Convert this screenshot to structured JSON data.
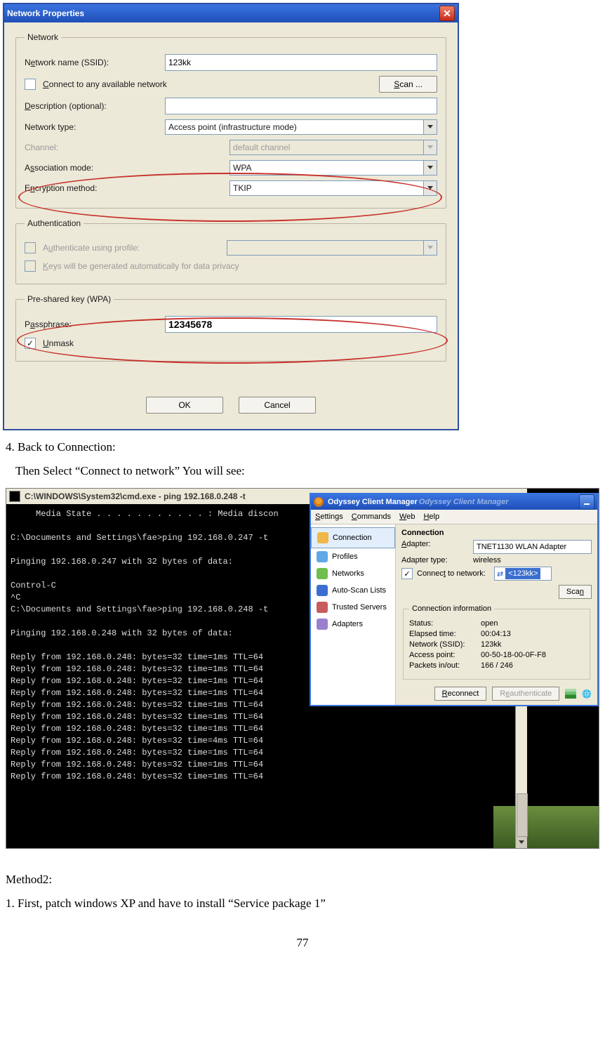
{
  "dialog": {
    "title": "Network Properties",
    "groups": {
      "network": {
        "legend": "Network",
        "ssid_label_pre": "N",
        "ssid_label_ul": "e",
        "ssid_label_post": "twork name (SSID):",
        "ssid_value": "123kk",
        "connect_any_pre": "",
        "connect_any_ul": "C",
        "connect_any_post": "onnect to any available network",
        "scan_pre": "",
        "scan_ul": "S",
        "scan_post": "can ...",
        "desc_ul": "D",
        "desc_post": "escription (optional):",
        "desc_value": "",
        "type_label": "Network type:",
        "type_value": "Access point (infrastructure mode)",
        "channel_label": "Channel:",
        "channel_value": "default channel",
        "assoc_pre": "A",
        "assoc_ul": "s",
        "assoc_post": "sociation mode:",
        "assoc_value": "WPA",
        "enc_pre": "E",
        "enc_ul": "n",
        "enc_post": "cryption method:",
        "enc_value": "TKIP"
      },
      "auth": {
        "legend": "Authentication",
        "auth_pre": "A",
        "auth_ul": "u",
        "auth_post": "thenticate using profile:",
        "keys_pre": "",
        "keys_ul": "K",
        "keys_post": "eys will be generated automatically for data privacy"
      },
      "psk": {
        "legend": "Pre-shared key (WPA)",
        "pass_pre": "P",
        "pass_ul": "a",
        "pass_post": "ssphrase:",
        "pass_value": "12345678",
        "unmask_ul": "U",
        "unmask_post": "nmask"
      }
    },
    "ok": "OK",
    "cancel": "Cancel"
  },
  "body": {
    "step4": "4. Back to Connection:",
    "step4b": "Then Select “Connect to network” You will see:",
    "method2": "Method2:",
    "method2_1": "1. First, patch windows XP and have to install “Service package 1”",
    "pagenum": "77"
  },
  "cmd": {
    "title": "C:\\WINDOWS\\System32\\cmd.exe - ping 192.168.0.248 -t",
    "lines": "     Media State . . . . . . . . . . . : Media discon\n\nC:\\Documents and Settings\\fae>ping 192.168.0.247 -t\n\nPinging 192.168.0.247 with 32 bytes of data:\n\nControl-C\n^C\nC:\\Documents and Settings\\fae>ping 192.168.0.248 -t\n\nPinging 192.168.0.248 with 32 bytes of data:\n\nReply from 192.168.0.248: bytes=32 time=1ms TTL=64\nReply from 192.168.0.248: bytes=32 time=1ms TTL=64\nReply from 192.168.0.248: bytes=32 time=1ms TTL=64\nReply from 192.168.0.248: bytes=32 time=1ms TTL=64\nReply from 192.168.0.248: bytes=32 time=1ms TTL=64\nReply from 192.168.0.248: bytes=32 time=1ms TTL=64\nReply from 192.168.0.248: bytes=32 time=1ms TTL=64\nReply from 192.168.0.248: bytes=32 time=4ms TTL=64\nReply from 192.168.0.248: bytes=32 time=1ms TTL=64\nReply from 192.168.0.248: bytes=32 time=1ms TTL=64\nReply from 192.168.0.248: bytes=32 time=1ms TTL=64"
  },
  "ocm": {
    "title": "Odyssey Client Manager",
    "menu": {
      "settings": "Settings",
      "settings_ul": "S",
      "commands": "Commands",
      "commands_ul": "C",
      "web": "Web",
      "web_ul": "W",
      "help": "Help",
      "help_ul": "H"
    },
    "side": [
      "Connection",
      "Profiles",
      "Networks",
      "Auto-Scan Lists",
      "Trusted Servers",
      "Adapters"
    ],
    "main": {
      "heading": "Connection",
      "adapter_ul": "A",
      "adapter_post": "dapter:",
      "adapter_value": "TNET1130 WLAN Adapter",
      "adapter_type_lbl": "Adapter type:",
      "adapter_type_val": "wireless",
      "connect_pre": "Connec",
      "connect_ul": "t",
      "connect_post": " to network:",
      "network_value": "<123kk>",
      "scan_pre": "Sca",
      "scan_ul": "n",
      "ci_legend": "Connection information",
      "status_lbl": "Status:",
      "status_val": "open",
      "elapsed_lbl": "Elapsed time:",
      "elapsed_val": "00:04:13",
      "ssid_lbl": "Network (SSID):",
      "ssid_val": "123kk",
      "ap_lbl": "Access point:",
      "ap_val": "00-50-18-00-0F-F8",
      "pkts_lbl": "Packets in/out:",
      "pkts_val": "166 / 246",
      "reconnect_ul": "R",
      "reconnect_post": "econnect",
      "reauth_pre": "R",
      "reauth_ul": "e",
      "reauth_post": "authenticate"
    }
  }
}
